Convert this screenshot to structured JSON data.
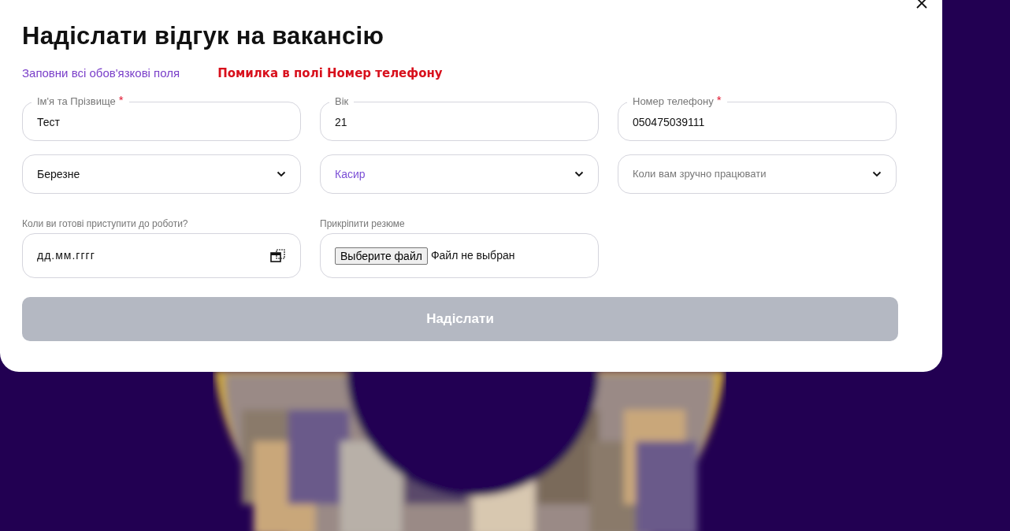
{
  "dialog": {
    "title": "Надіслати відгук на вакансію",
    "hint": "Заповни всі обов'язкові поля",
    "error": "Помилка в полі Номер телефону",
    "fields": [
      {
        "kind": "text",
        "label": "Ім'я та Прізвище",
        "required_mark": "*",
        "value": "Тест"
      },
      {
        "kind": "text",
        "label": "Вік",
        "value": "21"
      },
      {
        "kind": "text",
        "label": "Номер телефону",
        "required_mark": "*",
        "value": "050475039111"
      },
      {
        "kind": "select",
        "value": "Березне",
        "active": false
      },
      {
        "kind": "select",
        "value": "Касир",
        "active": true
      },
      {
        "kind": "select",
        "placeholder": "Коли вам зручно працювати"
      },
      {
        "kind": "date",
        "label": "Коли ви готові приступити до роботи?",
        "placeholder": "дд.мм.гггг"
      },
      {
        "kind": "file",
        "label": "Прикріпити резюме",
        "button": "Выберите файл",
        "status": "Файл не выбран"
      }
    ],
    "submit": {
      "label": "Надіслати",
      "disabled": true
    }
  }
}
